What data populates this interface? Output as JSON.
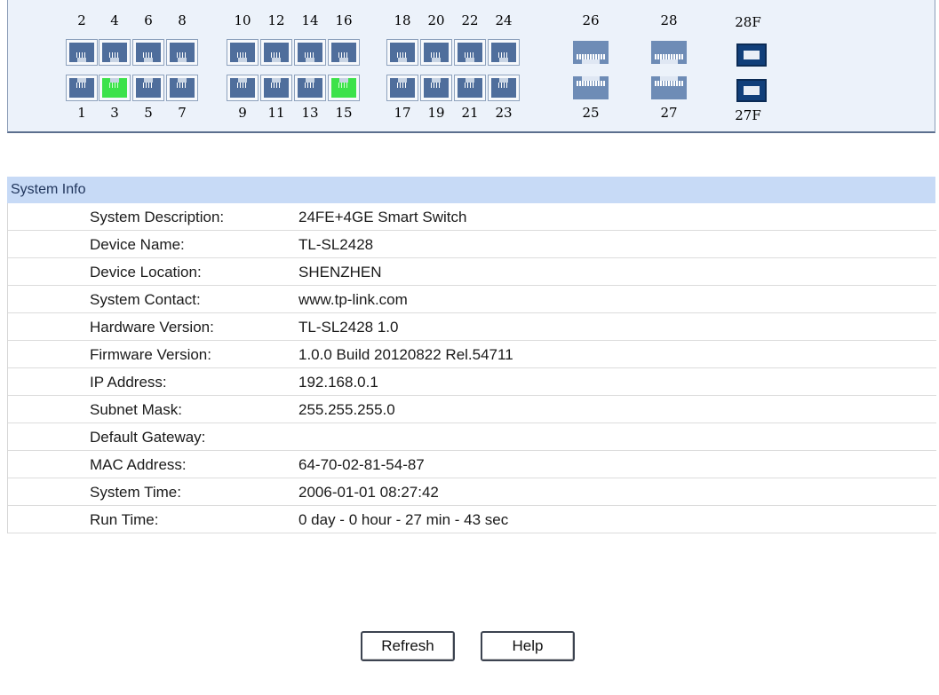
{
  "panel": {
    "top_numbers": [
      "2",
      "4",
      "6",
      "8",
      "10",
      "12",
      "14",
      "16",
      "18",
      "20",
      "22",
      "24",
      "26",
      "28",
      "28F"
    ],
    "bottom_numbers": [
      "1",
      "3",
      "5",
      "7",
      "9",
      "11",
      "13",
      "15",
      "17",
      "19",
      "21",
      "23",
      "25",
      "27",
      "27F"
    ],
    "link_up_ports": [
      "3",
      "15"
    ],
    "colors": {
      "link_up": "#3ce24a",
      "link_down": "#4f6e9c",
      "sfp": "#113f7a"
    }
  },
  "info": {
    "header": "System Info",
    "rows": [
      {
        "label": "System Description:",
        "value": "24FE+4GE Smart Switch"
      },
      {
        "label": "Device Name:",
        "value": "TL-SL2428"
      },
      {
        "label": "Device Location:",
        "value": "SHENZHEN"
      },
      {
        "label": "System Contact:",
        "value": "www.tp-link.com"
      },
      {
        "label": "Hardware Version:",
        "value": "TL-SL2428 1.0"
      },
      {
        "label": "Firmware Version:",
        "value": "1.0.0 Build 20120822 Rel.54711"
      },
      {
        "label": "IP Address:",
        "value": "192.168.0.1"
      },
      {
        "label": "Subnet Mask:",
        "value": "255.255.255.0"
      },
      {
        "label": "Default Gateway:",
        "value": ""
      },
      {
        "label": "MAC Address:",
        "value": "64-70-02-81-54-87"
      },
      {
        "label": "System Time:",
        "value": "2006-01-01 08:27:42"
      },
      {
        "label": "Run Time:",
        "value": "0 day - 0 hour - 27 min - 43 sec"
      }
    ]
  },
  "buttons": {
    "refresh": "Refresh",
    "help": "Help"
  }
}
